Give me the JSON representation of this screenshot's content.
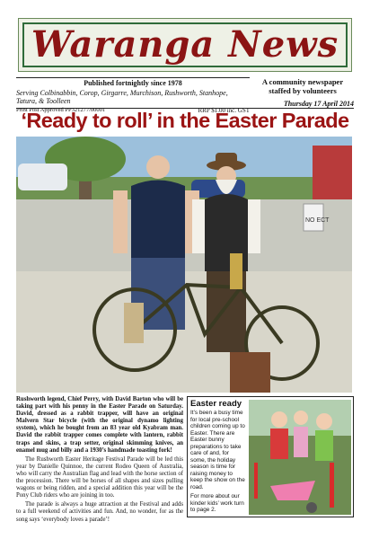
{
  "masthead": {
    "title": "Waranga News"
  },
  "publication": {
    "frequency": "Published fortnightly since 1978",
    "serving": "Serving Colbinabbin, Corop, Girgarre, Murchison, Rushworth, Stanhope, Tatura, & Toolleen",
    "print_post": "Print Post Approved PP321277/00001",
    "price": "RRP $1.00 inc. GST"
  },
  "community": "A community newspaper staffed by volunteers",
  "issue_date": "Thursday 17 April 2014",
  "headline": "‘Ready to roll’ in the Easter Parade",
  "photo": {
    "sign": "NO ECT",
    "colors": {
      "vest": "#1c2b4a",
      "hat": "#6a4a2a",
      "bike": "#3a3a22"
    }
  },
  "caption": {
    "lead": "Rushworth legend, Chief Perry, with David Barton who will be taking part with his penny in the Easter Parade on Saturday. David, dressed as a rabbit trapper, will have an original Malvern Star bicycle (with the original dynamo lighting system), which he bought from an 83 year old Kyabram man. David the rabbit trapper comes complete with lantern, rabbit traps and skins, a trap setter, original skimming knives, an enamel mug and billy and a 1930’s handmade toasting fork!",
    "p2": "The Rushworth Easter Heritage Festival Parade will be led this year by Danielle Quinnoe, the current Rodeo Queen of Australia, who will carry the Australian flag and lead with the horse section of the procession. There will be horses of all shapes and sizes pulling wagons or being ridden, and a special addition this year will be the Pony Club riders who are joining in too.",
    "p3": "The parade is always a huge attraction at the Festival and adds to a full weekend of activities and fun. And, no wonder, for as the song says ‘everybody loves a parade’!"
  },
  "sidebar": {
    "title": "Easter ready",
    "body": "It’s been a busy time for local pre-school children coming up to Easter. There are Easter bunny preparations to take care of and, for some, the holiday season is time for raising money to keep the show on the road.",
    "more": "For more about our kinder kids’ work turn to page 2."
  }
}
